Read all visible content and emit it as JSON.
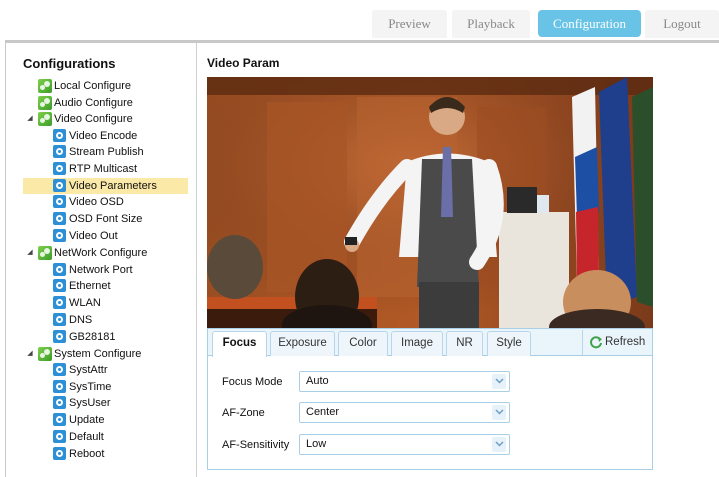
{
  "nav": {
    "preview": "Preview",
    "playback": "Playback",
    "configuration": "Configuration",
    "logout": "Logout"
  },
  "sidebar": {
    "title": "Configurations",
    "groups": [
      {
        "label": "Local Configure",
        "children": []
      },
      {
        "label": "Audio Configure",
        "children": []
      },
      {
        "label": "Video Configure",
        "children": [
          "Video Encode",
          "Stream Publish",
          "RTP Multicast",
          "Video Parameters",
          "Video OSD",
          "OSD Font Size",
          "Video Out"
        ]
      },
      {
        "label": "NetWork Configure",
        "children": [
          "Network Port",
          "Ethernet",
          "WLAN",
          "DNS",
          "GB28181"
        ]
      },
      {
        "label": "System Configure",
        "children": [
          "SystAttr",
          "SysTime",
          "SysUser",
          "Update",
          "Default",
          "Reboot"
        ]
      }
    ],
    "selected": "Video Parameters"
  },
  "main": {
    "title": "Video Param",
    "tabs": [
      "Focus",
      "Exposure",
      "Color",
      "Image",
      "NR",
      "Style"
    ],
    "active_tab": "Focus",
    "refresh_label": "Refresh",
    "fields": [
      {
        "label": "Focus Mode",
        "value": "Auto"
      },
      {
        "label": "AF-Zone",
        "value": "Center"
      },
      {
        "label": "AF-Sensitivity",
        "value": "Low"
      }
    ]
  },
  "colors": {
    "accent": "#68c3e6",
    "selected_row": "#fbe9a8",
    "tab_border": "#a9cfe6"
  }
}
